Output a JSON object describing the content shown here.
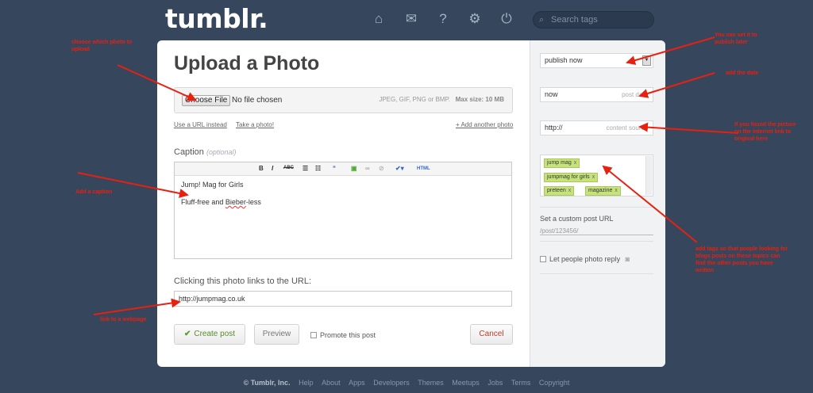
{
  "header": {
    "logo": "tumblr.",
    "nav_icons": [
      "home-icon",
      "mail-icon",
      "help-icon",
      "gear-icon",
      "power-icon"
    ],
    "search_placeholder": "Search tags"
  },
  "main": {
    "title": "Upload a Photo",
    "file_button": "Choose File",
    "file_status": "No file chosen",
    "file_hint": "JPEG, GIF, PNG or BMP.",
    "file_max": "Max size: 10 MB",
    "use_url_link": "Use a URL instead",
    "take_photo_link": "Take a photo!",
    "add_photo_link": "+ Add another photo",
    "caption_label": "Caption",
    "caption_optional": "(optional)",
    "caption_line1": "Jump! Mag for Girls",
    "caption_line2_a": "Fluff-free and ",
    "caption_line2_b": "Bieber",
    "caption_line2_c": "-less",
    "click_url_label": "Clicking this photo links to the URL:",
    "click_url_value": "http://jumpmag.co.uk",
    "create_button": "Create post",
    "preview_button": "Preview",
    "promote_label": "Promote this post",
    "cancel_button": "Cancel"
  },
  "sidebar": {
    "publish_select": "publish now",
    "post_date_value": "now",
    "post_date_placeholder": "post date",
    "source_value": "http://",
    "source_placeholder": "content source",
    "tags": [
      "jump mag",
      "jumpmag for girls",
      "preteen",
      "magazine"
    ],
    "tag_remove": "x",
    "custom_url_label": "Set a custom post URL",
    "custom_url_value": "/post/123456/",
    "reply_label": "Let people photo reply"
  },
  "annotations": {
    "choose_photo": "choose which photo to upload",
    "set_publish": "You can set it to publish later",
    "add_date": "add the date",
    "source_note": "If you found the picture on the internet link to original here",
    "add_caption": "Add a caption",
    "tags_note": "add tags so that people looking for blogs posts on these topics can find the other posts you have written",
    "link_webpage": "link to a webpage"
  },
  "footer": {
    "copyright": "© Tumblr, Inc.",
    "links": [
      "Help",
      "About",
      "Apps",
      "Developers",
      "Themes",
      "Meetups",
      "Jobs",
      "Terms",
      "Copyright"
    ]
  },
  "colors": {
    "background": "#36465d",
    "annotation": "#e8200f",
    "tag": "#c6e27b"
  }
}
